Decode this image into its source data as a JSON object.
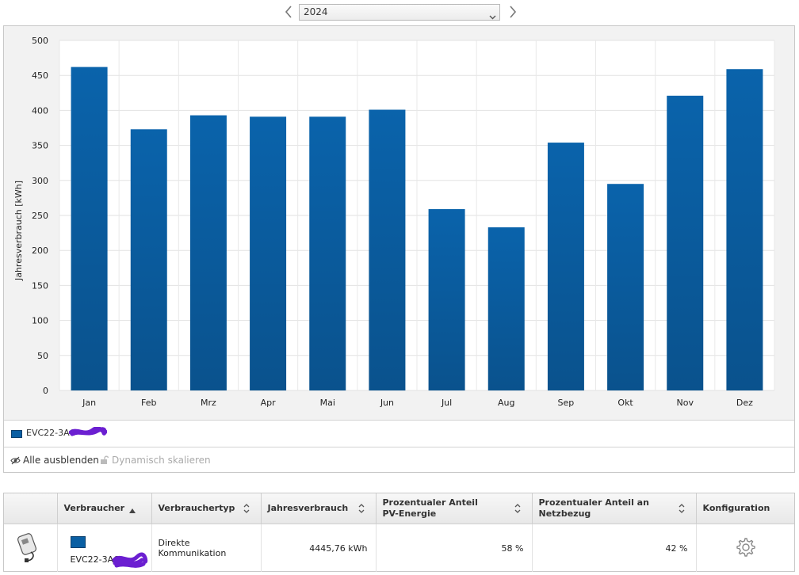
{
  "year_selector": {
    "value": "2024",
    "prev_icon": "chevron-left-icon",
    "next_icon": "chevron-right-icon"
  },
  "chart_data": {
    "type": "bar",
    "ylabel": "Jahresverbrauch [kWh]",
    "xlabel": "",
    "ylim": [
      0,
      500
    ],
    "yticks": [
      "0",
      "50",
      "100",
      "150",
      "200",
      "250",
      "300",
      "350",
      "400",
      "450",
      "500"
    ],
    "grid": true,
    "categories": [
      "Jan",
      "Feb",
      "Mrz",
      "Apr",
      "Mai",
      "Jun",
      "Jul",
      "Aug",
      "Sep",
      "Okt",
      "Nov",
      "Dez"
    ],
    "series": [
      {
        "name": "EVC22-3AC",
        "color": "#0a5fa3",
        "values": [
          462,
          373,
          393,
          391,
          391,
          401,
          259,
          233,
          354,
          295,
          421,
          459
        ]
      }
    ]
  },
  "legend": {
    "entry_label": "EVC22-3AC"
  },
  "actions": {
    "hide_all_label": "Alle ausblenden",
    "dynamic_scale_label": "Dynamisch skalieren"
  },
  "table": {
    "headers": {
      "consumer": "Verbraucher",
      "consumer_type": "Verbrauchertyp",
      "annual": "Jahresverbrauch",
      "pv_share": "Prozentualer Anteil PV-Energie",
      "grid_share": "Prozentualer Anteil an Netzbezug",
      "config": "Konfiguration"
    },
    "rows": [
      {
        "icon": "wallbox-charger-icon",
        "name": "EVC22-3AC",
        "color": "#0a5fa3",
        "type": "Direkte Kommunikation",
        "annual": "4445,76 kWh",
        "pv_share": "58 %",
        "grid_share": "42 %",
        "config_icon": "gear-icon"
      }
    ]
  }
}
